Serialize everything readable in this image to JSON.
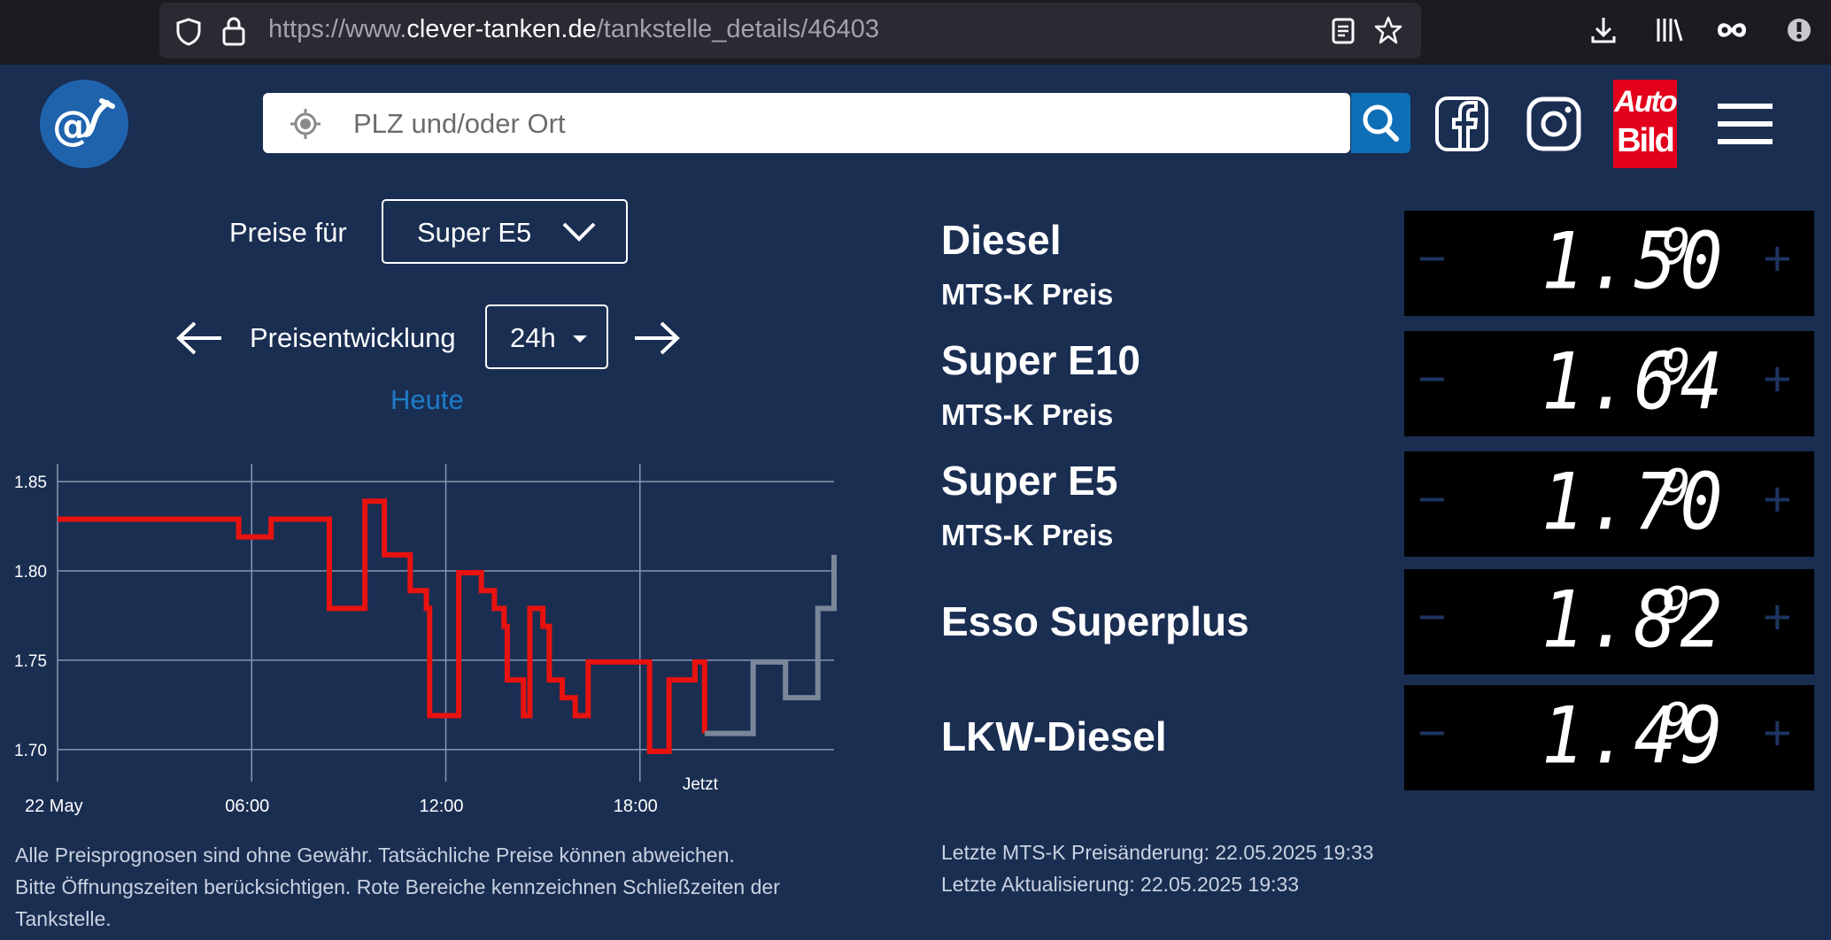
{
  "browser": {
    "url_prefix": "https://www.",
    "url_host": "clever-tanken.de",
    "url_path": "/tankstelle_details/46403"
  },
  "header": {
    "logo_text": "@",
    "search_placeholder": "PLZ und/oder Ort",
    "autobild_line1": "Auto",
    "autobild_line2": "Bild"
  },
  "controls": {
    "prices_for_label": "Preise für",
    "fuel_selected": "Super E5",
    "trend_label": "Preisentwicklung",
    "period_selected": "24h",
    "day_label": "Heute"
  },
  "chart_data": {
    "type": "line",
    "title": "",
    "x_tick_labels": [
      "22 May",
      "06:00",
      "12:00",
      "18:00"
    ],
    "now_label": "Jetzt",
    "x_range_hours": [
      0,
      24
    ],
    "y_tick_labels": [
      "1.70",
      "1.75",
      "1.80",
      "1.85"
    ],
    "ylim": [
      1.69,
      1.855
    ],
    "grid": true,
    "series": [
      {
        "color": "#e8120f",
        "step": true,
        "x": [
          0,
          5.6,
          6.6,
          8.4,
          9.5,
          10.1,
          10.9,
          11.4,
          11.5,
          12.4,
          13.1,
          13.5,
          13.8,
          13.9,
          14.4,
          14.6,
          15.0,
          15.2,
          15.6,
          16.0,
          16.4,
          18.3,
          18.9,
          19.7,
          20.0
        ],
        "y": [
          1.829,
          1.819,
          1.829,
          1.779,
          1.839,
          1.809,
          1.789,
          1.779,
          1.719,
          1.799,
          1.789,
          1.779,
          1.769,
          1.739,
          1.719,
          1.779,
          1.769,
          1.739,
          1.729,
          1.719,
          1.749,
          1.699,
          1.739,
          1.749,
          1.709
        ]
      },
      {
        "color": "#7a879b",
        "step": true,
        "x": [
          20.0,
          20.5,
          21.5,
          22.5,
          23.5,
          24.0
        ],
        "y": [
          1.709,
          1.709,
          1.749,
          1.729,
          1.779,
          1.809
        ]
      }
    ]
  },
  "disclaimer": [
    "Alle Preisprognosen sind ohne Gewähr. Tatsächliche Preise können abweichen.",
    "Bitte Öffnungszeiten berücksichtigen. Rote Bereiche kennzeichnen Schließzeiten der",
    "Tankstelle."
  ],
  "prices": [
    {
      "name": "Diesel",
      "sub": "MTS-K Preis",
      "main": "1.50",
      "last": "9"
    },
    {
      "name": "Super E10",
      "sub": "MTS-K Preis",
      "main": "1.64",
      "last": "9"
    },
    {
      "name": "Super E5",
      "sub": "MTS-K Preis",
      "main": "1.70",
      "last": "9"
    },
    {
      "name": "Esso Superplus",
      "sub": "",
      "main": "1.82",
      "last": "9"
    },
    {
      "name": "LKW-Diesel",
      "sub": "",
      "main": "1.49",
      "last": "9"
    }
  ],
  "price_buttons": {
    "minus": "−",
    "plus": "+"
  },
  "updates": {
    "last_change": "Letzte MTS-K Preisänderung: 22.05.2025 19:33",
    "last_update": "Letzte Aktualisierung: 22.05.2025 19:33"
  }
}
